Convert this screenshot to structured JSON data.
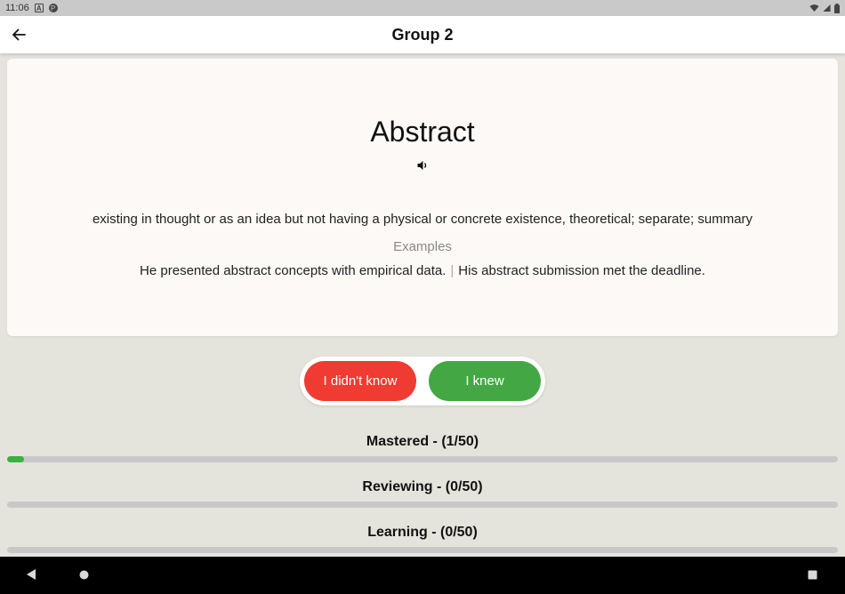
{
  "status_bar": {
    "time": "11:06",
    "icons": [
      "a-box-icon",
      "p-circle-icon",
      "wifi-icon",
      "signal-icon",
      "battery-icon"
    ]
  },
  "app_bar": {
    "title": "Group 2",
    "back_icon": "arrow-back-icon"
  },
  "card": {
    "word": "Abstract",
    "speaker_icon": "volume-icon",
    "definition": "existing in thought or as an idea but not having a physical or concrete existence, theoretical; separate; summary",
    "examples_label": "Examples",
    "examples": [
      "He presented abstract concepts with empirical data.",
      "His abstract submission met the deadline."
    ],
    "example_separator": "|"
  },
  "answers": {
    "didnt_know_label": "I didn't know",
    "knew_label": "I knew",
    "didnt_know_color": "#ef3b32",
    "knew_color": "#43a843"
  },
  "progress": [
    {
      "label": "Mastered - (1/50)",
      "value": 1,
      "total": 50
    },
    {
      "label": "Reviewing - (0/50)",
      "value": 0,
      "total": 50
    },
    {
      "label": "Learning - (0/50)",
      "value": 0,
      "total": 50
    }
  ],
  "colors": {
    "progress_fill": "#3cb043",
    "progress_track": "#c8c8c8",
    "background": "#e5e4dc",
    "card": "#fcf9f7"
  },
  "nav_bar": {
    "icons": [
      "nav-back-icon",
      "nav-home-icon",
      "nav-recents-icon"
    ]
  }
}
